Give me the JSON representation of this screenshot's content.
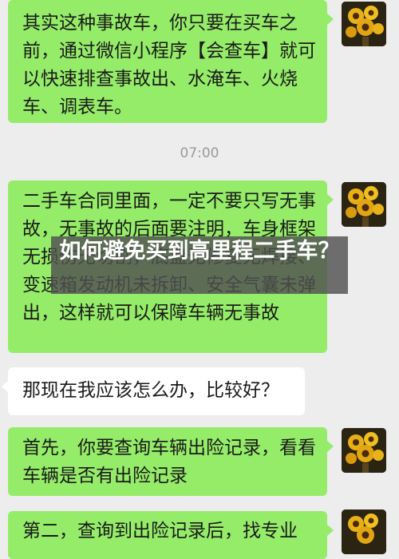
{
  "messages": [
    {
      "side": "me",
      "text": "其实这种事故车，你只要在买车之前，通过微信小程序【会查车】就可以快速排查事故出、水淹车、火烧车、调表车。"
    },
    {
      "time": "07:00"
    },
    {
      "side": "me",
      "text": "二手车合同里面，一定不要只写无事故，无事故的后面要注明，车身框架无损伤无切割，底盘无修复无焊接、变速箱发动机未拆卸、安全气囊未弹出，这样就可以保障车辆无事故"
    },
    {
      "side": "other",
      "text": "那现在我应该怎么办，比较好？"
    },
    {
      "side": "me",
      "text": "首先，你要查询车辆出险记录，看看车辆是否有出险记录"
    },
    {
      "side": "me",
      "text": "第二，查询到出险记录后，找专业"
    }
  ],
  "overlay_title": "如何避免买到高里程二手车？",
  "avatar_icon": "sunflower-avatar-icon"
}
